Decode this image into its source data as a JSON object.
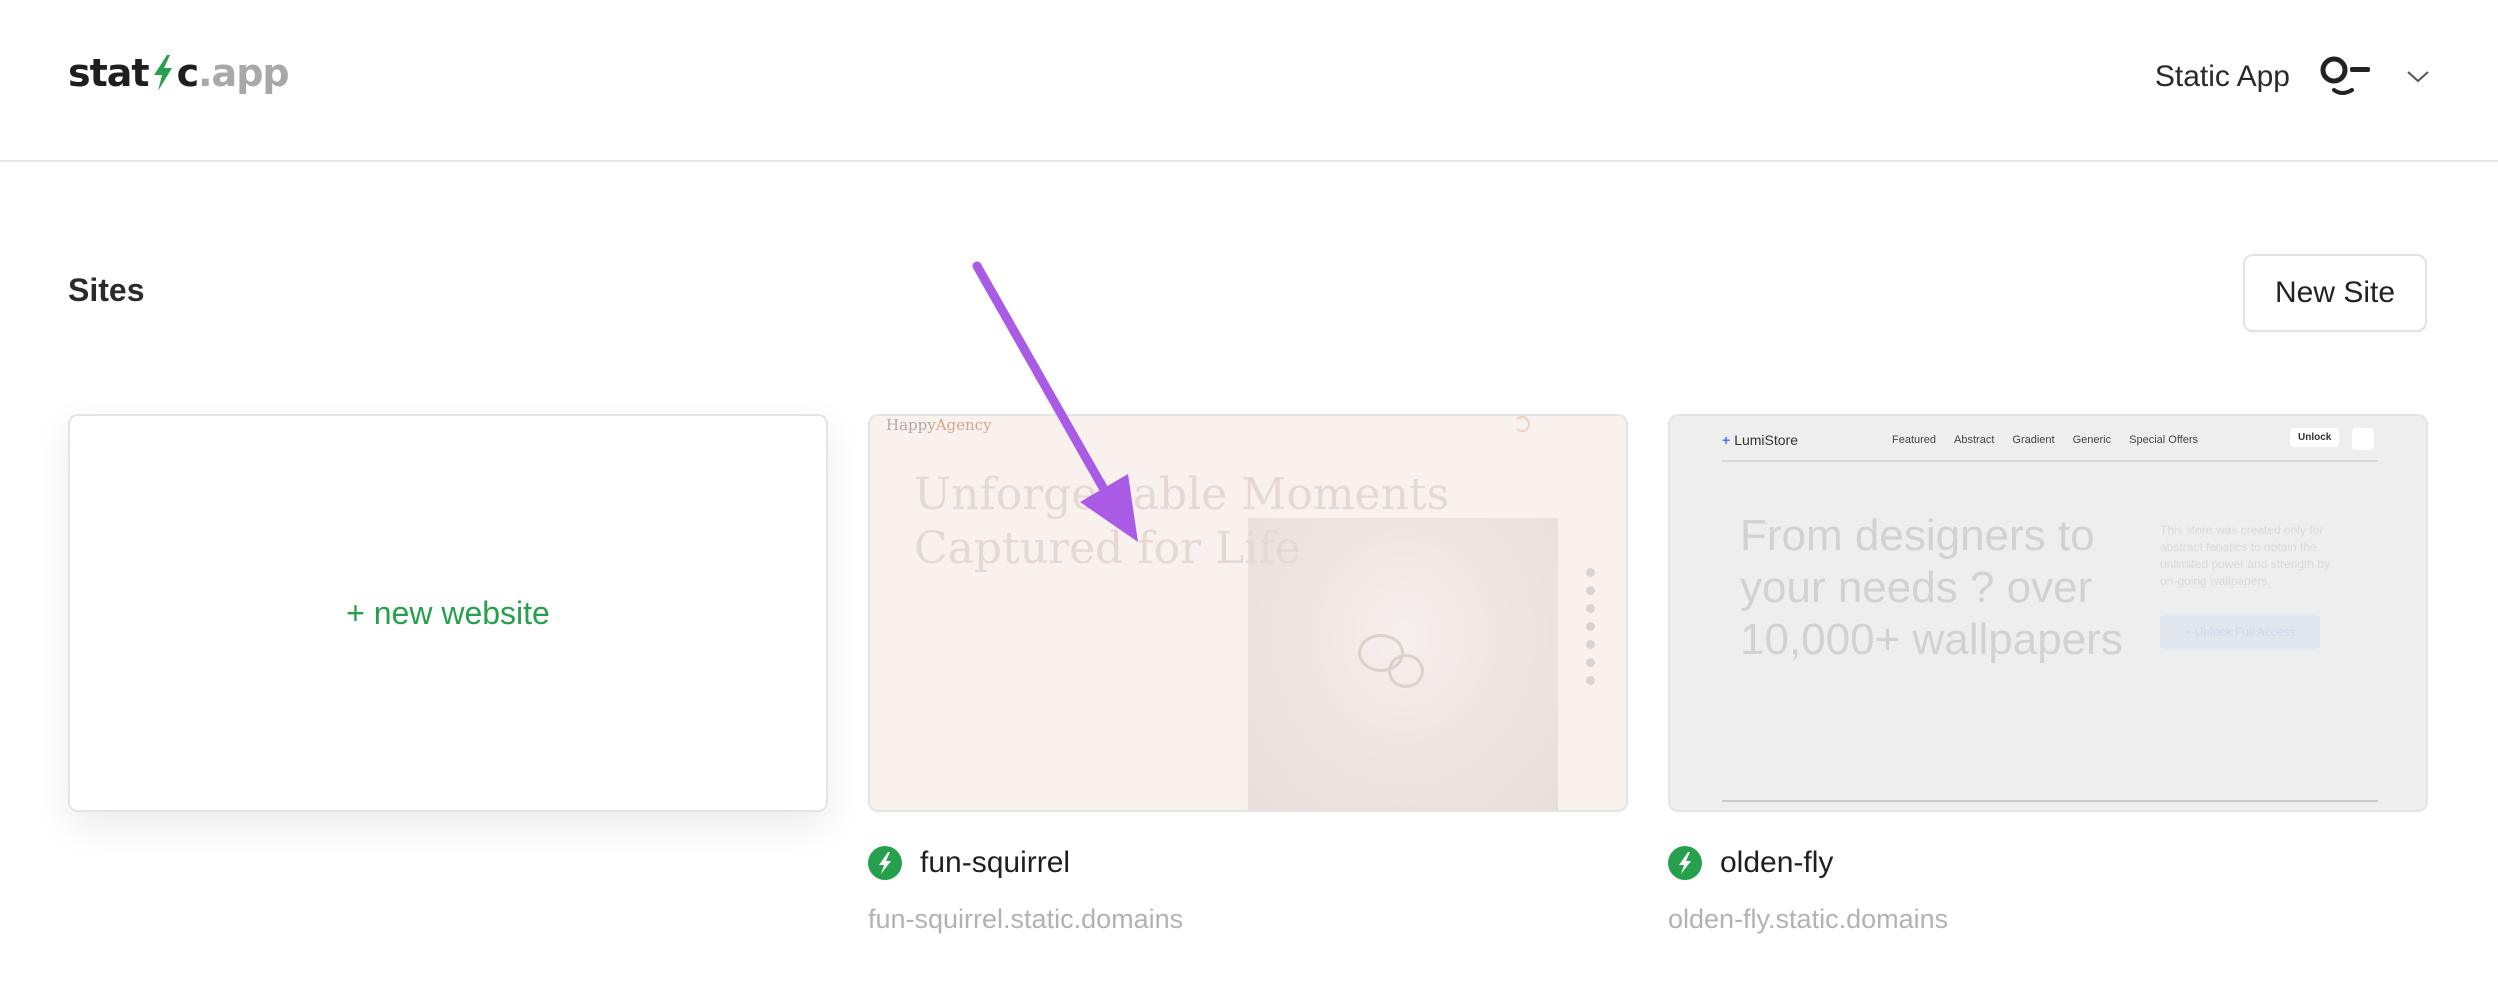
{
  "header": {
    "logo": {
      "part1": "stat",
      "part2": "c",
      "part3": ".app",
      "bolt_color": "#27a04d"
    },
    "account_name": "Static App",
    "icons": {
      "avatar": "user-avatar-icon",
      "chevron": "chevron-down-icon"
    }
  },
  "sites": {
    "title": "Sites",
    "new_site_button": "New Site",
    "new_website_card": "+ new website",
    "items": [
      {
        "name": "fun-squirrel",
        "url": "fun-squirrel.static.domains",
        "preview": {
          "brand_a": "Happy",
          "brand_b": "Agency",
          "headline_1": "Unforgettable Moments",
          "headline_2": "Captured for Life"
        }
      },
      {
        "name": "olden-fly",
        "url": "olden-fly.static.domains",
        "preview": {
          "logo": "LumiStore",
          "menu": [
            "Featured",
            "Abstract",
            "Gradient",
            "Generic",
            "Special Offers"
          ],
          "unlock": "Unlock",
          "headline": "From designers to your needs ? over 10,000+ wallpapers",
          "copy": "This store was created only for abstract fanatics to obtain the unlimited power and strength by on-going wallpapers.",
          "cta": "+ Unlock Full Access"
        }
      }
    ]
  },
  "colors": {
    "accent_green": "#27a04d",
    "annotation_arrow": "#a95be6"
  }
}
